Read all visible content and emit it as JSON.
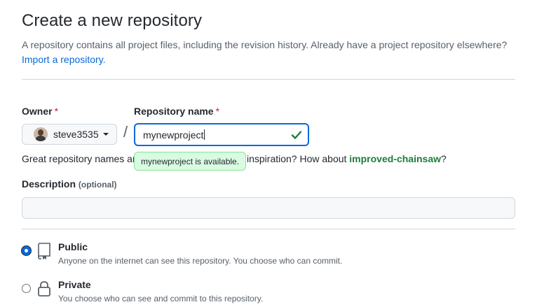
{
  "header": {
    "title": "Create a new repository",
    "subtitle": "A repository contains all project files, including the revision history. Already have a project repository elsewhere?",
    "import_link": "Import a repository."
  },
  "owner": {
    "label": "Owner",
    "required_mark": "*",
    "value": "steve3535"
  },
  "separator": "/",
  "repo_name": {
    "label": "Repository name",
    "required_mark": "*",
    "value": "mynewproject",
    "availability_tooltip": "mynewproject is available."
  },
  "hint": {
    "prefix": "Great repository names ar",
    "middle": "Need inspiration? How about ",
    "suggestion": "improved-chainsaw",
    "suffix": "?"
  },
  "description": {
    "label": "Description",
    "optional": "(optional)",
    "value": ""
  },
  "visibility": {
    "selected": "public",
    "options": [
      {
        "id": "public",
        "title": "Public",
        "desc": "Anyone on the internet can see this repository. You choose who can commit.",
        "icon": "repo-icon"
      },
      {
        "id": "private",
        "title": "Private",
        "desc": "You choose who can see and commit to this repository.",
        "icon": "lock-icon"
      }
    ]
  },
  "colors": {
    "accent": "#0969da",
    "success": "#1a7f37",
    "danger": "#cf222e",
    "border": "#d0d7de",
    "muted": "#57606a"
  }
}
